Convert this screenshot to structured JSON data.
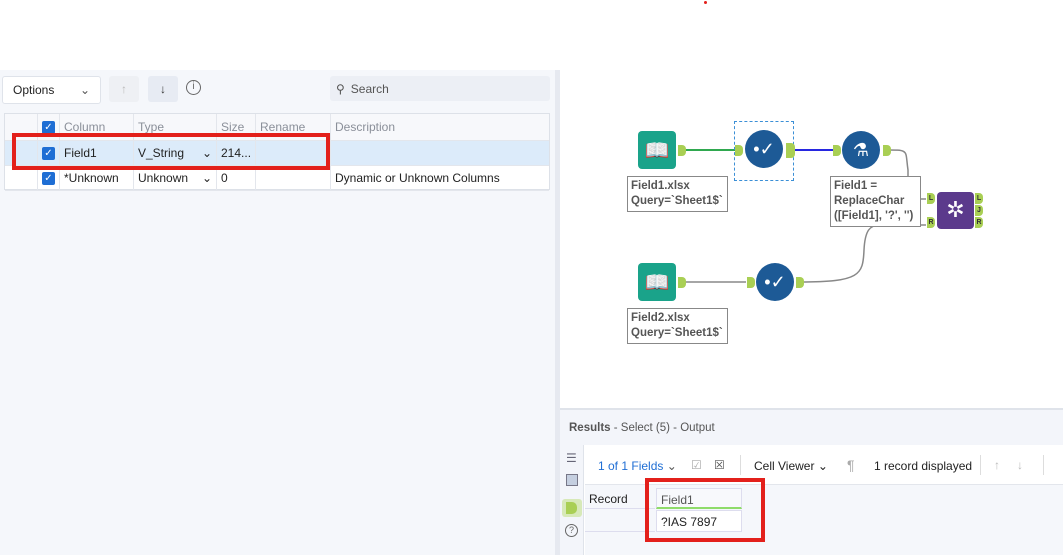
{
  "config": {
    "options_label": "Options",
    "search_placeholder": "Search",
    "headers": [
      "Column",
      "Type",
      "Size",
      "Rename",
      "Description"
    ],
    "rows": [
      {
        "column": "Field1",
        "type": "V_String",
        "size": "214...",
        "rename": "",
        "description": ""
      },
      {
        "column": "*Unknown",
        "type": "Unknown",
        "size": "0",
        "rename": "",
        "description": "Dynamic or Unknown Columns"
      }
    ]
  },
  "canvas": {
    "input1_label": [
      "Field1.xlsx",
      "Query=`Sheet1$`"
    ],
    "input2_label": [
      "Field2.xlsx",
      "Query=`Sheet1$`"
    ],
    "formula_label": [
      "Field1 =",
      "ReplaceChar",
      "([Field1], '?', '')"
    ],
    "join_anchors": {
      "left": "L",
      "right": "R",
      "out": [
        "L",
        "J",
        "R"
      ]
    }
  },
  "results": {
    "title": "Results",
    "subtitle": "- Select (5) - Output",
    "fields": "1 of 1 Fields",
    "viewer": "Cell Viewer",
    "count": "1 record displayed",
    "headers": [
      "Record",
      "Field1"
    ],
    "rows": [
      [
        "",
        "?IAS 7897"
      ]
    ]
  },
  "colors": {
    "accent": "#1f6ed4",
    "highlight": "#e3201b",
    "node": "#1d5a96",
    "input": "#1aa38a",
    "join": "#5b3a8c"
  }
}
